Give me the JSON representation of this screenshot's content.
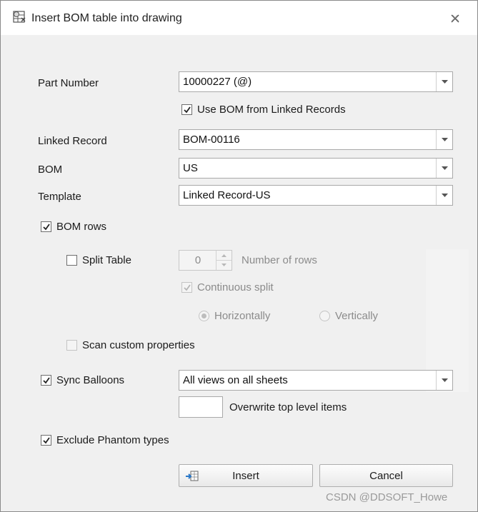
{
  "window": {
    "title": "Insert BOM table into drawing"
  },
  "fields": {
    "part_number": {
      "label": "Part Number",
      "value": "10000227 (@)"
    },
    "use_bom_linked": {
      "label": "Use BOM from Linked Records",
      "checked": true
    },
    "linked_record": {
      "label": "Linked Record",
      "value": "BOM-00116"
    },
    "bom": {
      "label": "BOM",
      "value": "US"
    },
    "template": {
      "label": "Template",
      "value": "Linked Record-US"
    }
  },
  "bom_rows": {
    "label": "BOM rows",
    "checked": true,
    "split_table": {
      "label": "Split Table",
      "checked": false
    },
    "rows": {
      "value": "0",
      "label": "Number of rows"
    },
    "continuous_split": {
      "label": "Continuous split",
      "checked": true,
      "disabled": true
    },
    "orientation": {
      "horizontally": "Horizontally",
      "vertically": "Vertically",
      "selected": "horizontally"
    },
    "scan_custom": {
      "label": "Scan custom properties",
      "checked": false
    }
  },
  "sync_balloons": {
    "label": "Sync Balloons",
    "checked": true,
    "value": "All views on all sheets",
    "overwrite_label": "Overwrite top level items"
  },
  "exclude_phantom": {
    "label": "Exclude Phantom types",
    "checked": true
  },
  "buttons": {
    "insert": "Insert",
    "cancel": "Cancel"
  },
  "watermark": "CSDN @DDSOFT_Howe",
  "colors": {
    "accent": "#2a78c8",
    "disabled_text": "#8b8b8b",
    "background": "#f0f0f0"
  }
}
